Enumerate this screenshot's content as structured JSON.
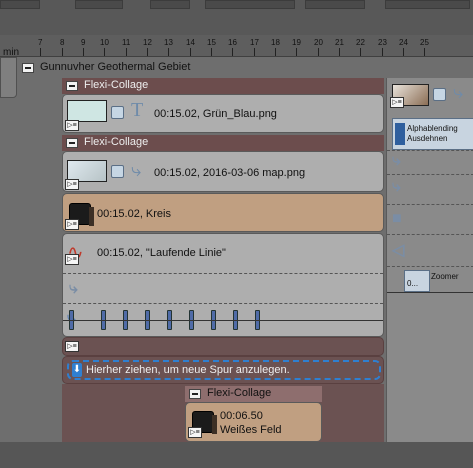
{
  "ruler": {
    "unit_label": "min",
    "ticks": [
      "7",
      "8",
      "9",
      "10",
      "11",
      "12",
      "13",
      "14",
      "15",
      "16",
      "17",
      "18",
      "19",
      "20",
      "21",
      "22",
      "23",
      "24",
      "25"
    ]
  },
  "project": {
    "title": "Gunnuvher Geothermal Gebiet"
  },
  "collage1": {
    "title": "Flexi-Collage",
    "clip": "00:15.02, Grün_Blau.png"
  },
  "collage2": {
    "title": "Flexi-Collage",
    "clip_map": "00:15.02, 2016-03-06 map.png",
    "clip_kreis": "00:15.02, Kreis",
    "clip_line": "00:15.02, \"Laufende Linie\""
  },
  "droptarget": {
    "label": "Hierher ziehen, um neue Spur anzulegen."
  },
  "collage3": {
    "title": "Flexi-Collage",
    "time": "00:06.50",
    "name": "Weißes Feld"
  },
  "rightpanel": {
    "alpha_line1": "Alphablending",
    "alpha_line2": "Ausdehnen",
    "zoom_label": "Zoomer",
    "zoom_value": "0..."
  },
  "colors": {
    "clip_gray": "#aeaeae",
    "clip_tan": "#c09f81",
    "collage_rose": "#6b5252",
    "drop_border": "#2f7fd0"
  }
}
